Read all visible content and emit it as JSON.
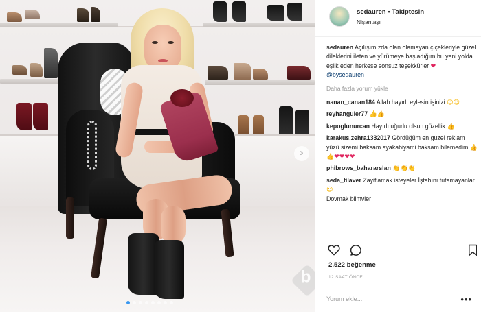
{
  "header": {
    "username": "sedauren",
    "separator": " • ",
    "follow_label": "Takiptesin",
    "location": "Nişantaşı"
  },
  "caption": {
    "username": "sedauren",
    "text": "Açılışımızda olan olamayan çiçekleriyle güzel dileklerini ileten ve yürümeye başladığım bu yeni yolda eşlik eden herkese sonsuz teşekkürler",
    "emoji": "heart",
    "mention": "@bysedauren"
  },
  "load_more_label": "Daha fazla yorum yükle",
  "comments": [
    {
      "username": "nanan_canan184",
      "text": "Allah hayırlı eylesin işinizi",
      "emojis": [
        "heart-eyes",
        "heart-eyes"
      ]
    },
    {
      "username": "reyhanguler77",
      "text": "",
      "emojis": [
        "thumbs-up",
        "thumbs-up"
      ]
    },
    {
      "username": "kepoglunurcan",
      "text": "Hayırlı uğurlu olsun güzellik",
      "emojis": [
        "thumbs-up"
      ]
    },
    {
      "username": "karakus.zehra1332017",
      "text": "Gördüğüm en guzel reklam yüzü sizemi baksam ayakabiyami baksam bilemedim",
      "emojis": [
        "thumbs-up",
        "thumbs-up",
        "heart",
        "heart",
        "heart",
        "heart"
      ]
    },
    {
      "username": "phibrows_bahararslan",
      "text": "",
      "emojis": [
        "clap",
        "clap",
        "clap"
      ]
    },
    {
      "username": "seda_tilaver",
      "text": "Zayiflamak isteyeler İştahını tutamayanlar",
      "emojis": [
        "smile"
      ],
      "continued": "Dovmak bilmvler"
    }
  ],
  "likes_label": "2.522 beğenme",
  "time_label": "12 SAAT ÖNCE",
  "comment_box": {
    "placeholder": "Yorum ekle...",
    "more_label": "•••"
  },
  "photo": {
    "carousel_count": 8,
    "carousel_active": 0,
    "next_glyph": "›",
    "watermark_letter": "b"
  },
  "icons": {
    "like": "heart-outline-icon",
    "comment": "speech-bubble-icon",
    "save": "bookmark-icon",
    "next": "chevron-right-icon"
  },
  "colors": {
    "link": "#003569",
    "muted": "#999999",
    "heart": "#e0245e",
    "carousel_active": "#3897f0"
  }
}
